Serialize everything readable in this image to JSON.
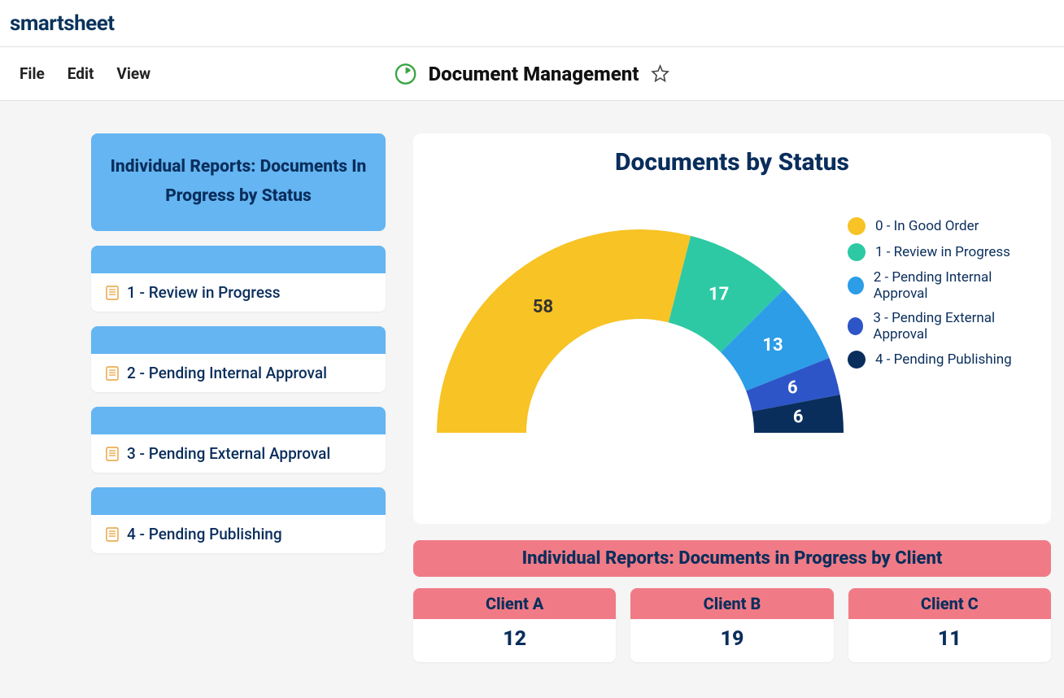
{
  "app": {
    "logo": "smartsheet"
  },
  "menu": {
    "file": "File",
    "edit": "Edit",
    "view": "View"
  },
  "header": {
    "title": "Document Management"
  },
  "sidebar": {
    "main_title": "Individual Reports: Documents In Progress by Status",
    "items": [
      {
        "label": "1 - Review in Progress"
      },
      {
        "label": "2 - Pending Internal Approval"
      },
      {
        "label": "3 - Pending External Approval"
      },
      {
        "label": "4 - Pending Publishing"
      }
    ]
  },
  "chart_data": {
    "type": "pie",
    "title": "Documents by Status",
    "series": [
      {
        "name": "0 - In Good Order",
        "value": 58,
        "color": "#f7c325"
      },
      {
        "name": "1 - Review in Progress",
        "value": 17,
        "color": "#2dc9a4"
      },
      {
        "name": "2 - Pending Internal Approval",
        "value": 13,
        "color": "#2d9de8"
      },
      {
        "name": "3 - Pending External Approval",
        "value": 6,
        "color": "#2d55c7"
      },
      {
        "name": "4 - Pending Publishing",
        "value": 6,
        "color": "#0a2e5c"
      }
    ]
  },
  "client_section": {
    "title": "Individual Reports: Documents in Progress by Client",
    "clients": [
      {
        "name": "Client A",
        "value": "12"
      },
      {
        "name": "Client B",
        "value": "19"
      },
      {
        "name": "Client C",
        "value": "11"
      }
    ]
  }
}
